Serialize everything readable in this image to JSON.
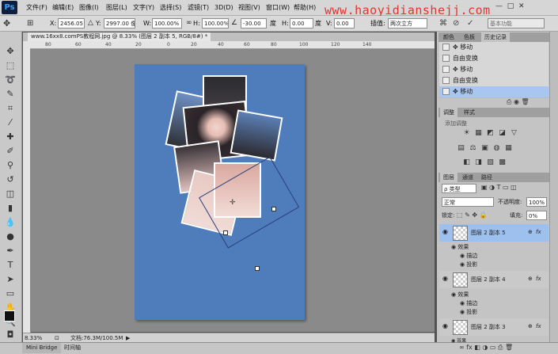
{
  "app": {
    "logo": "Ps"
  },
  "menu": [
    "文件(F)",
    "编辑(E)",
    "图像(I)",
    "图层(L)",
    "文字(Y)",
    "选择(S)",
    "滤镜(T)",
    "3D(D)",
    "视图(V)",
    "窗口(W)",
    "帮助(H)"
  ],
  "watermark": "www.haoyidianshejj.com",
  "options": {
    "x_label": "X:",
    "x_value": "2456.05 像",
    "y_label": "Y:",
    "y_value": "2997.00 像",
    "w_label": "W:",
    "w_value": "100.00%",
    "h_label": "H:",
    "h_value": "100.00%",
    "angle_value": "-30.00",
    "angle_unit": "度",
    "hskew_label": "H:",
    "hskew_value": "0.00",
    "hskew_unit": "度",
    "vskew_label": "V:",
    "vskew_value": "0.00",
    "interp_label": "插值:",
    "interp_value": "两次立方",
    "preset": "基本功能"
  },
  "document": {
    "tab": "www.16xx8.comPS教程网.jpg @ 8.33% (图层 2 副本 5, RGB/8#) *",
    "ruler_top": [
      "80",
      "60",
      "40",
      "20",
      "0",
      "20",
      "40",
      "60",
      "80",
      "100",
      "120",
      "140"
    ],
    "zoom": "8.33%",
    "doc_size": "文档:76.3M/100.5M"
  },
  "bottom_tabs": [
    "Mini Bridge",
    "时间轴"
  ],
  "history": {
    "tabs": [
      "颜色",
      "色板",
      "历史记录"
    ],
    "items": [
      "移动",
      "自由变换",
      "移动",
      "自由变换",
      "移动"
    ]
  },
  "adjustments": {
    "tabs": [
      "调整",
      "样式"
    ],
    "title": "添加调整",
    "row1": [
      "☀",
      "▦",
      "◩",
      "◪",
      "▽"
    ],
    "row2": [
      "▤",
      "⚖",
      "▣",
      "◍",
      "▦"
    ],
    "row3": [
      "◧",
      "◨",
      "▧",
      "▩"
    ]
  },
  "layers": {
    "tabs": [
      "图层",
      "通道",
      "路径"
    ],
    "filter": "ρ 类型",
    "blend": "正常",
    "opacity_label": "不透明度:",
    "opacity": "100%",
    "lock_label": "锁定:",
    "fill_label": "填充:",
    "fill": "0%",
    "items": [
      {
        "name": "图层 2 副本 5",
        "effects": "效果",
        "stroke": "描边",
        "shadow": "投影"
      },
      {
        "name": "图层 2 副本 4",
        "effects": "效果",
        "stroke": "描边",
        "shadow": "投影"
      },
      {
        "name": "图层 2 副本 3",
        "effects": "效果"
      }
    ],
    "fx": "fx"
  }
}
